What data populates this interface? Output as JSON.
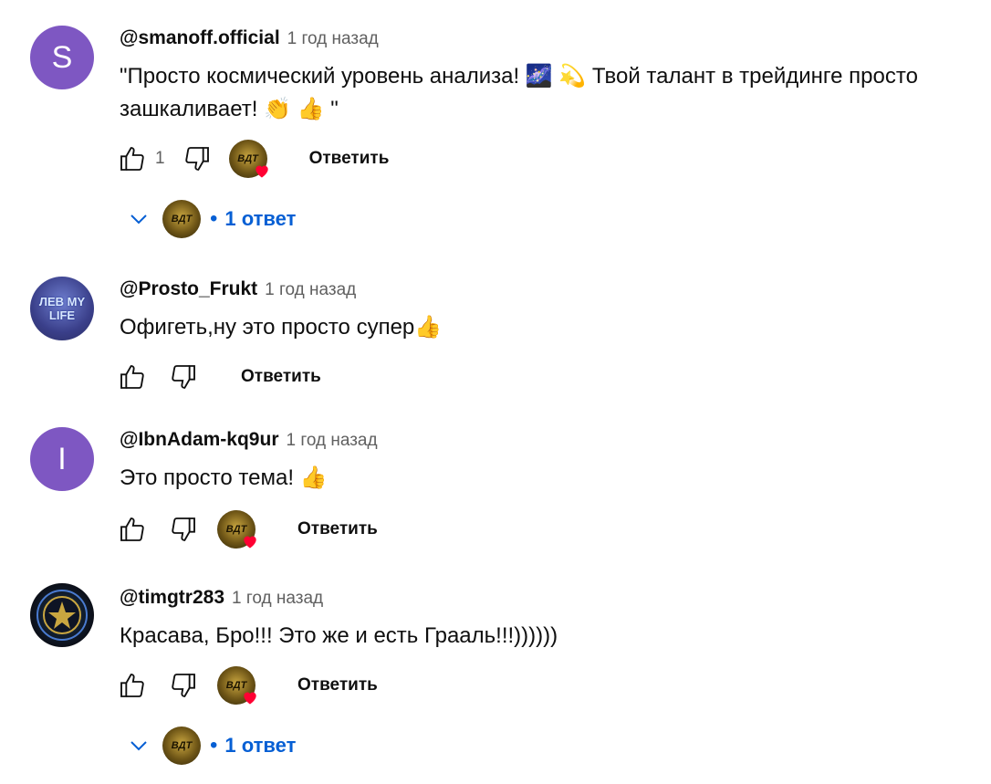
{
  "comments": [
    {
      "author": "@smanoff.official",
      "time": "1 год назад",
      "avatar_letter": "S",
      "text_line1": "\"Просто космический уровень анализа! 🌌 💫 Твой талант в трейдинге просто",
      "text_line2": "зашкаливает! 👏 👍 \"",
      "like_count": "1",
      "reply_label": "Ответить",
      "replies_label": "1 ответ",
      "has_heart": true
    },
    {
      "author": "@Prosto_Frukt",
      "time": "1 год назад",
      "avatar_text": "ЛЕВ MY LIFE",
      "text_line1": "Офигеть,ну это просто супер👍",
      "reply_label": "Ответить",
      "has_heart": false
    },
    {
      "author": "@IbnAdam-kq9ur",
      "time": "1 год назад",
      "avatar_letter": "I",
      "text_line1": "Это просто тема! 👍",
      "reply_label": "Ответить",
      "has_heart": true
    },
    {
      "author": "@timgtr283",
      "time": "1 год назад",
      "text_line1": "Красава, Бро!!! Это же и есть Грааль!!!))))))",
      "reply_label": "Ответить",
      "replies_label": "1 ответ",
      "has_heart": true
    }
  ],
  "creator_badge": "ВДТ",
  "colors": {
    "accent": "#065fd4",
    "avatar_purple": "#7e57c2",
    "heart": "#ff0033"
  }
}
